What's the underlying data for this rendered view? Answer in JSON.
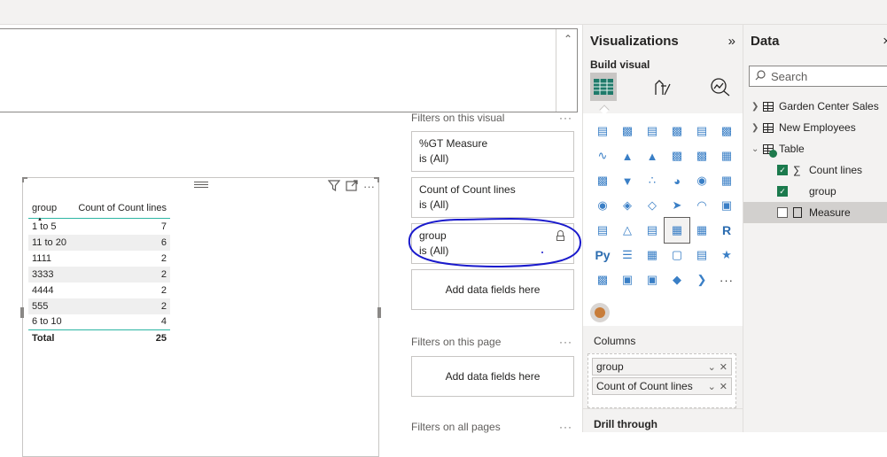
{
  "textbox": {
    "scroll_glyph": "^"
  },
  "visual": {
    "table": {
      "columns": [
        "group",
        "Count of Count lines"
      ],
      "rows": [
        [
          "1 to 5",
          "7"
        ],
        [
          "11 to 20",
          "6"
        ],
        [
          "1111",
          "2"
        ],
        [
          "3333",
          "2"
        ],
        [
          "4444",
          "2"
        ],
        [
          "555",
          "2"
        ],
        [
          "6 to 10",
          "4"
        ]
      ],
      "total": [
        "Total",
        "25"
      ]
    },
    "toolbar_icons": [
      "filter-icon",
      "focus-mode-icon",
      "more-options-icon"
    ]
  },
  "filters": {
    "on_visual_heading": "Filters on this visual",
    "on_page_heading": "Filters on this page",
    "all_pages_heading": "Filters on all pages",
    "dots": "···",
    "cards": [
      {
        "title": "%GT Measure",
        "state": "is (All)"
      },
      {
        "title": "Count of Count lines",
        "state": "is (All)"
      },
      {
        "title": "group",
        "state": "is (All)"
      }
    ],
    "add_fields": "Add data fields here",
    "annotation_color": "#1a1acc"
  },
  "visualizations": {
    "title": "Visualizations",
    "collapse": "»",
    "build_label": "Build visual",
    "wells_label": "Columns",
    "wells": [
      "group",
      "Count of Count lines"
    ],
    "drill_label": "Drill through",
    "gallery_r": "R",
    "gallery_py": "Py",
    "gallery_more": "···"
  },
  "data": {
    "title": "Data",
    "close": "×",
    "search_placeholder": "Search",
    "tables": [
      {
        "name": "Garden Center Sales",
        "expanded": false
      },
      {
        "name": "New Employees",
        "expanded": false
      },
      {
        "name": "Table",
        "expanded": true
      }
    ],
    "fields": [
      {
        "name": "Count lines",
        "checked": true,
        "kind": "sum"
      },
      {
        "name": "group",
        "checked": true,
        "kind": "column"
      },
      {
        "name": "Measure",
        "checked": false,
        "kind": "measure"
      }
    ]
  },
  "colors": {
    "accent": "#2cb5a3",
    "checkbox_on": "#1b7a4d"
  }
}
